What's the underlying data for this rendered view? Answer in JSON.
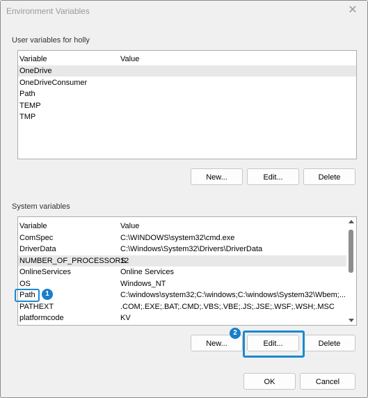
{
  "window": {
    "title": "Environment Variables",
    "close_glyph": "✕"
  },
  "user_vars": {
    "group_label": "User variables for holly",
    "header": {
      "variable": "Variable",
      "value": "Value"
    },
    "rows": [
      {
        "variable": "OneDrive",
        "value": ""
      },
      {
        "variable": "OneDriveConsumer",
        "value": ""
      },
      {
        "variable": "Path",
        "value": ""
      },
      {
        "variable": "TEMP",
        "value": ""
      },
      {
        "variable": "TMP",
        "value": ""
      }
    ],
    "buttons": {
      "new": "New...",
      "edit": "Edit...",
      "delete": "Delete"
    }
  },
  "system_vars": {
    "group_label": "System variables",
    "header": {
      "variable": "Variable",
      "value": "Value"
    },
    "rows": [
      {
        "variable": "ComSpec",
        "value": "C:\\WINDOWS\\system32\\cmd.exe"
      },
      {
        "variable": "DriverData",
        "value": "C:\\Windows\\System32\\Drivers\\DriverData"
      },
      {
        "variable": "NUMBER_OF_PROCESSORS",
        "value": "12"
      },
      {
        "variable": "OnlineServices",
        "value": "Online Services"
      },
      {
        "variable": "OS",
        "value": "Windows_NT"
      },
      {
        "variable": "Path",
        "value": "C:\\windows\\system32;C:\\windows;C:\\windows\\System32\\Wbem;..."
      },
      {
        "variable": "PATHEXT",
        "value": ".COM;.EXE;.BAT;.CMD;.VBS;.VBE;.JS;.JSE;.WSF;.WSH;.MSC"
      },
      {
        "variable": "platformcode",
        "value": "KV"
      }
    ],
    "buttons": {
      "new": "New...",
      "edit": "Edit...",
      "delete": "Delete"
    }
  },
  "footer": {
    "ok": "OK",
    "cancel": "Cancel"
  },
  "annotations": {
    "step1": "1",
    "step2": "2",
    "highlight_color": "#1a8ad0"
  }
}
